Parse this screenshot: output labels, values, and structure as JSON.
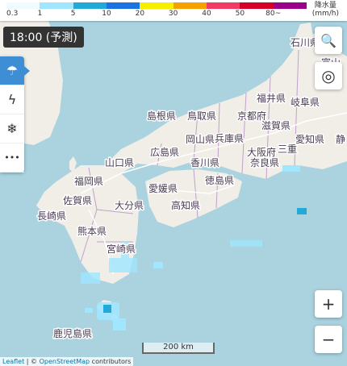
{
  "legend": {
    "ticks": [
      "0.3",
      "1",
      "5",
      "10",
      "20",
      "30",
      "40",
      "50",
      "80~"
    ],
    "colors": [
      "#f0fbff",
      "#a0e6ff",
      "#23a9d8",
      "#1a73e0",
      "#f6ef00",
      "#f5a200",
      "#f03c64",
      "#d4002a",
      "#9a0089"
    ],
    "unit_line1": "降水量",
    "unit_line2": "(mm/h)"
  },
  "time_label": "18:00 (予測)",
  "side_toolbar": {
    "items": [
      {
        "name": "rain-cloud-icon",
        "glyph": "☂",
        "active": true
      },
      {
        "name": "lightning-icon",
        "glyph": "ϟ",
        "active": false
      },
      {
        "name": "snowflake-icon",
        "glyph": "❄",
        "active": false
      },
      {
        "name": "more-icon",
        "glyph": "•••",
        "active": false
      }
    ]
  },
  "right_controls": {
    "search_glyph": "🔍",
    "locate_glyph": "◎",
    "zoom_in": "+",
    "zoom_out": "−"
  },
  "map": {
    "labels": {
      "ishikawa": "石川県",
      "toyama": "富山",
      "fukui": "福井県",
      "gifu": "岐阜県",
      "shimane": "島根県",
      "tottori": "鳥取県",
      "kyoto": "京都府",
      "shiga": "滋賀県",
      "aichi": "愛知県",
      "shizu": "静",
      "hiroshima": "広島県",
      "okayama": "岡山県",
      "hyogo": "兵庫県",
      "osaka": "大阪府",
      "mie": "三重",
      "nara": "奈良県",
      "yamaguchi": "山口県",
      "kagawa": "香川県",
      "tokushima": "徳島県",
      "fukuoka": "福岡県",
      "ehime": "愛媛県",
      "kochi": "高知県",
      "saga": "佐賀県",
      "oita": "大分県",
      "nagasaki": "長崎県",
      "kumamoto": "熊本県",
      "miyazaki": "宮崎県",
      "kagoshima": "鹿児島県"
    }
  },
  "scale_label": "200 km",
  "attribution": {
    "leaflet": "Leaflet",
    "sep": " | © ",
    "osm": "OpenStreetMap",
    "contrib": " contributors"
  }
}
